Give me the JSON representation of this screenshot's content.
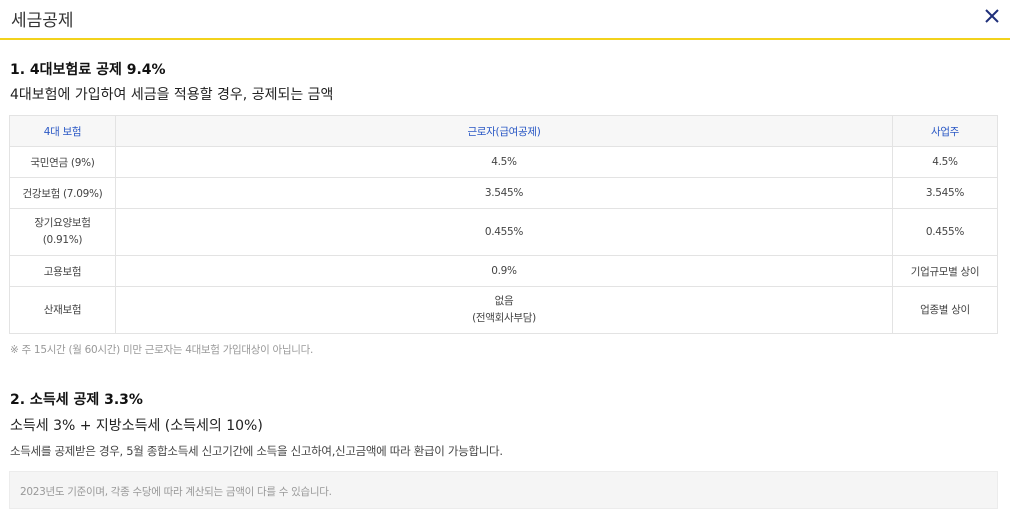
{
  "header": {
    "title": "세금공제",
    "close_icon": "close-icon",
    "accent_color": "#f2d21c"
  },
  "section1": {
    "heading": "1. 4대보험료 공제 9.4%",
    "description": "4대보험에 가입하여 세금을 적용할 경우, 공제되는 금액",
    "table": {
      "headers": [
        "4대 보험",
        "근로자(급여공제)",
        "사업주"
      ],
      "rows": [
        {
          "name": "국민연금 (9%)",
          "worker": "4.5%",
          "worker_sub": "",
          "employer": "4.5%"
        },
        {
          "name": "건강보험 (7.09%)",
          "worker": "3.545%",
          "worker_sub": "",
          "employer": "3.545%"
        },
        {
          "name": "장기요양보험",
          "name_sub": "(0.91%)",
          "worker": "0.455%",
          "worker_sub": "",
          "employer": "0.455%"
        },
        {
          "name": "고용보험",
          "worker": "0.9%",
          "worker_sub": "",
          "employer": "기업규모별 상이"
        },
        {
          "name": "산재보험",
          "worker": "없음",
          "worker_sub": "(전액회사부담)",
          "employer": "업종별 상이"
        }
      ]
    },
    "note": "※ 주 15시간 (월 60시간) 미만 근로자는 4대보험 가입대상이 아닙니다."
  },
  "section2": {
    "heading": "2. 소득세 공제 3.3%",
    "subheading": "소득세 3% + 지방소득세 (소득세의 10%)",
    "description": "소득세를 공제받은 경우, 5월 종합소득세 신고기간에 소득을 신고하여,신고금액에 따라 환급이 가능합니다.",
    "info": "2023년도 기준이며, 각종 수당에 따라 계산되는 금액이 다를 수 있습니다."
  }
}
